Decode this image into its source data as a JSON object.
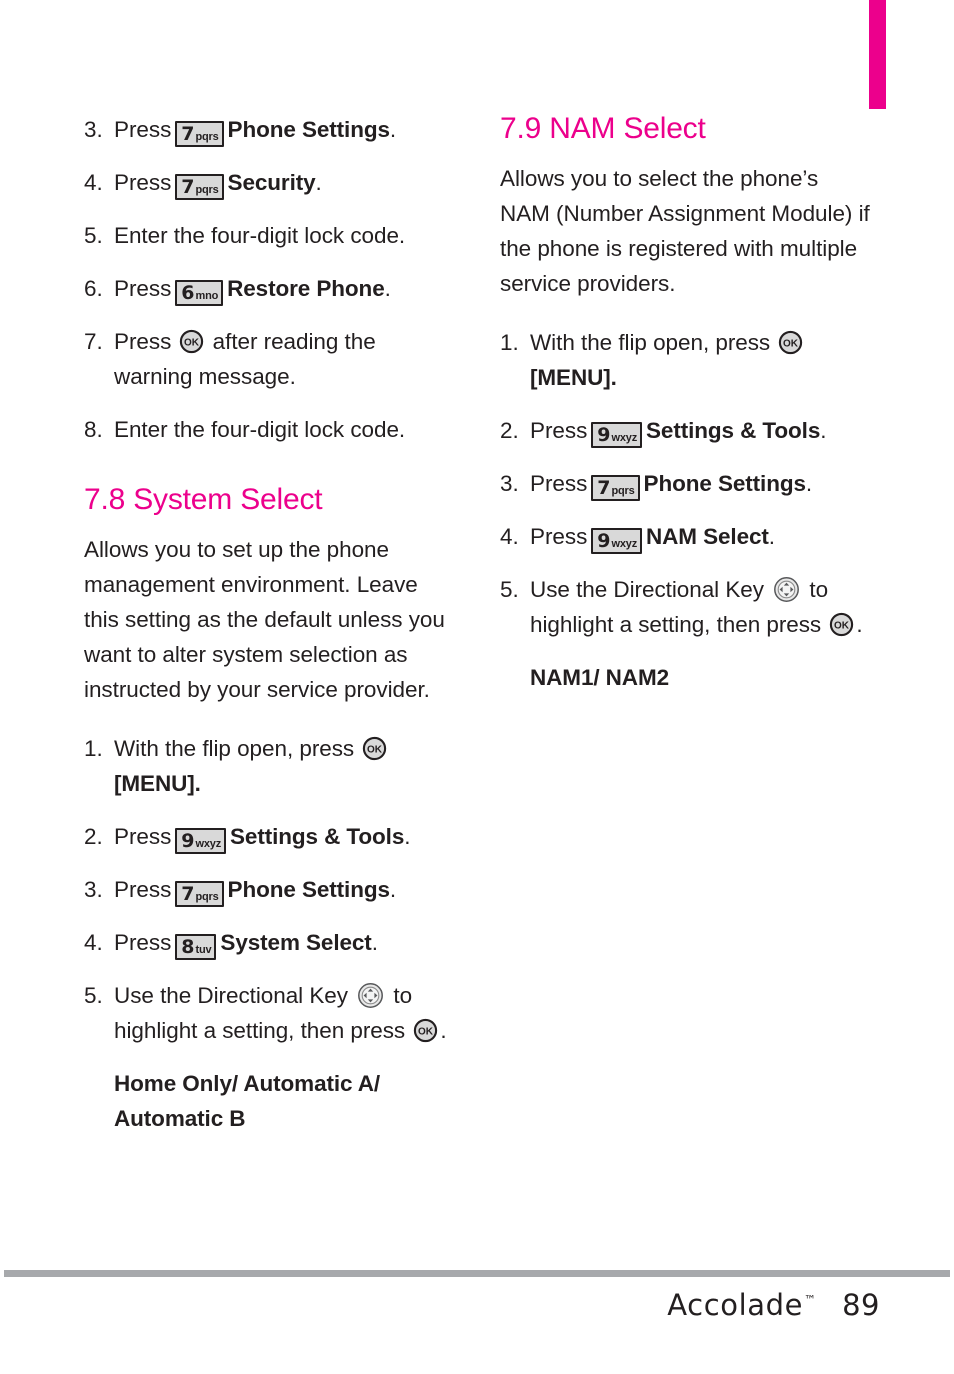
{
  "page": {
    "number": "89",
    "brand": "Accolade",
    "trademark": "™",
    "accent_color": "#ec008c",
    "rule_color": "#a7a9ac",
    "text_color": "#231f20"
  },
  "thumb_tab": {
    "color": "#ec008c"
  },
  "left_column": {
    "continued_steps": [
      {
        "num": "3.",
        "pre": "Press",
        "key": {
          "digit": "7",
          "letters": "pqrs"
        },
        "bold": "Phone Settings",
        "post": "."
      },
      {
        "num": "4.",
        "pre": "Press",
        "key": {
          "digit": "7",
          "letters": "pqrs"
        },
        "bold": "Security",
        "post": "."
      },
      {
        "num": "5.",
        "text": "Enter the four-digit lock code."
      },
      {
        "num": "6.",
        "pre": "Press",
        "key": {
          "digit": "6",
          "letters": "mno"
        },
        "bold": "Restore Phone",
        "post": "."
      },
      {
        "num": "7.",
        "pre": "Press",
        "icon": "ok-key-icon",
        "post": "after reading the warning message."
      },
      {
        "num": "8.",
        "text": "Enter the four-digit lock code."
      }
    ],
    "section": {
      "heading": "7.8 System Select",
      "intro": "Allows you to set up the phone management environment. Leave this setting as the default unless you want to alter system selection as instructed by your service provider.",
      "steps": [
        {
          "num": "1.",
          "pre": "With the flip open, press",
          "icon": "ok-key-icon",
          "post": "[MENU]."
        },
        {
          "num": "2.",
          "pre": "Press",
          "key": {
            "digit": "9",
            "letters": "wxyz"
          },
          "bold": "Settings & Tools",
          "post": "."
        },
        {
          "num": "3.",
          "pre": "Press",
          "key": {
            "digit": "7",
            "letters": "pqrs"
          },
          "bold": "Phone Settings",
          "post": "."
        },
        {
          "num": "4.",
          "pre": "Press",
          "key": {
            "digit": "8",
            "letters": "tuv"
          },
          "bold": "System Select",
          "post": "."
        },
        {
          "num": "5.",
          "pre": "Use the Directional Key",
          "icon": "directional-key-icon",
          "mid": "to highlight a setting, then press",
          "icon2": "ok-key-icon",
          "post": "."
        }
      ],
      "options": "Home Only/ Automatic A/ Automatic B"
    }
  },
  "right_column": {
    "section": {
      "heading": "7.9 NAM Select",
      "intro": "Allows you to select the phone’s NAM (Number Assignment Module) if the phone is registered with multiple service providers.",
      "steps": [
        {
          "num": "1.",
          "pre": "With the flip open, press",
          "icon": "ok-key-icon",
          "post": "[MENU]."
        },
        {
          "num": "2.",
          "pre": "Press",
          "key": {
            "digit": "9",
            "letters": "wxyz"
          },
          "bold": "Settings & Tools",
          "post": "."
        },
        {
          "num": "3.",
          "pre": "Press",
          "key": {
            "digit": "7",
            "letters": "pqrs"
          },
          "bold": "Phone Settings",
          "post": "."
        },
        {
          "num": "4.",
          "pre": "Press",
          "key": {
            "digit": "9",
            "letters": "wxyz"
          },
          "bold": "NAM Select",
          "post": "."
        },
        {
          "num": "5.",
          "pre": "Use the Directional Key",
          "icon": "directional-key-icon",
          "mid": "to highlight a setting, then press",
          "icon2": "ok-key-icon",
          "post": "."
        }
      ],
      "options": "NAM1/ NAM2"
    }
  }
}
